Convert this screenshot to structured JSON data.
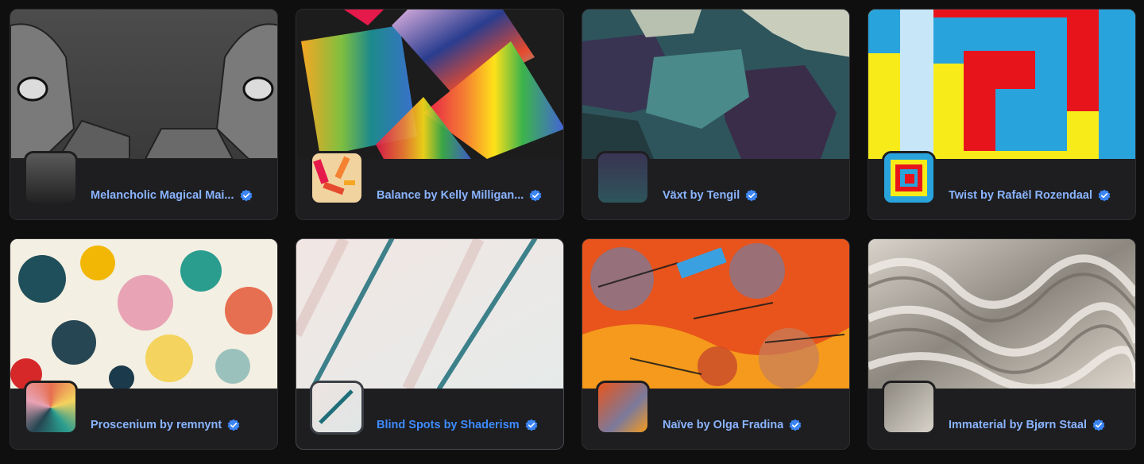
{
  "collections": [
    {
      "title": "Melancholic Magical Mai...",
      "verified": true
    },
    {
      "title": "Balance by Kelly Milligan...",
      "verified": true
    },
    {
      "title": "Växt by Tengil",
      "verified": true
    },
    {
      "title": "Twist by Rafaël Rozendaal",
      "verified": true
    },
    {
      "title": "Proscenium by remnynt",
      "verified": true
    },
    {
      "title": "Blind Spots by Shaderism",
      "verified": true
    },
    {
      "title": "Naïve by Olga Fradina",
      "verified": true
    },
    {
      "title": "Immaterial by Bjørn Staal",
      "verified": true
    }
  ],
  "colors": {
    "link": "#8ab4ff",
    "link_hover": "#3d8bff",
    "verified": "#3c85f5",
    "card_bg": "#1e1e20",
    "page_bg": "#0f0f10"
  }
}
